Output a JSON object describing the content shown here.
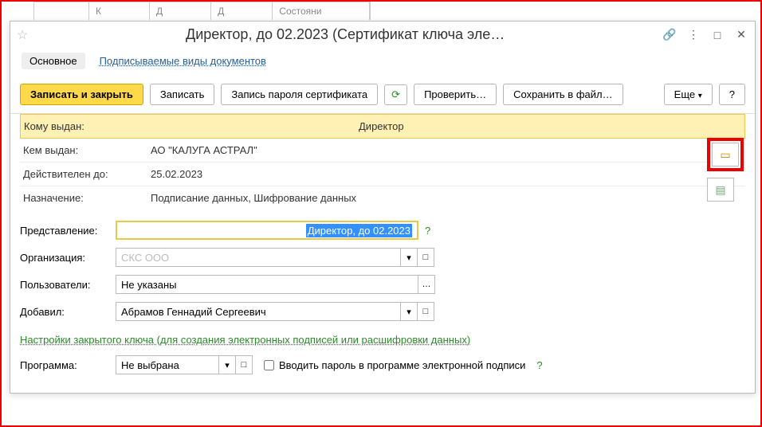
{
  "bg_tabs": [
    "",
    "К",
    "Д",
    "Д",
    "Состояни"
  ],
  "title": "Директор, до 02.2023 (Сертификат ключа эле…",
  "nav": {
    "main": "Основное",
    "docs": "Подписываемые виды документов"
  },
  "toolbar": {
    "save_close": "Записать и закрыть",
    "save": "Записать",
    "save_pwd": "Запись пароля сертификата",
    "check": "Проверить…",
    "save_file": "Сохранить в файл…",
    "more": "Еще",
    "help": "?"
  },
  "details": {
    "issued_to_label": "Кому выдан:",
    "issued_to_value": "Директор",
    "issued_by_label": "Кем выдан:",
    "issued_by_value": "АО \"КАЛУГА АСТРАЛ\"",
    "valid_until_label": "Действителен до:",
    "valid_until_value": "25.02.2023",
    "purpose_label": "Назначение:",
    "purpose_value": "Подписание данных, Шифрование данных"
  },
  "form": {
    "representation_label": "Представление:",
    "representation_value": "Директор, до 02.2023",
    "organization_label": "Организация:",
    "organization_value": "СКС ООО",
    "users_label": "Пользователи:",
    "users_value": "Не указаны",
    "added_by_label": "Добавил:",
    "added_by_value": "Абрамов Геннадий Сергеевич",
    "key_settings_link": "Настройки закрытого ключа (для создания электронных подписей или расшифровки данных)",
    "program_label": "Программа:",
    "program_value": "Не выбрана",
    "password_checkbox": "Вводить пароль в программе электронной подписи"
  }
}
